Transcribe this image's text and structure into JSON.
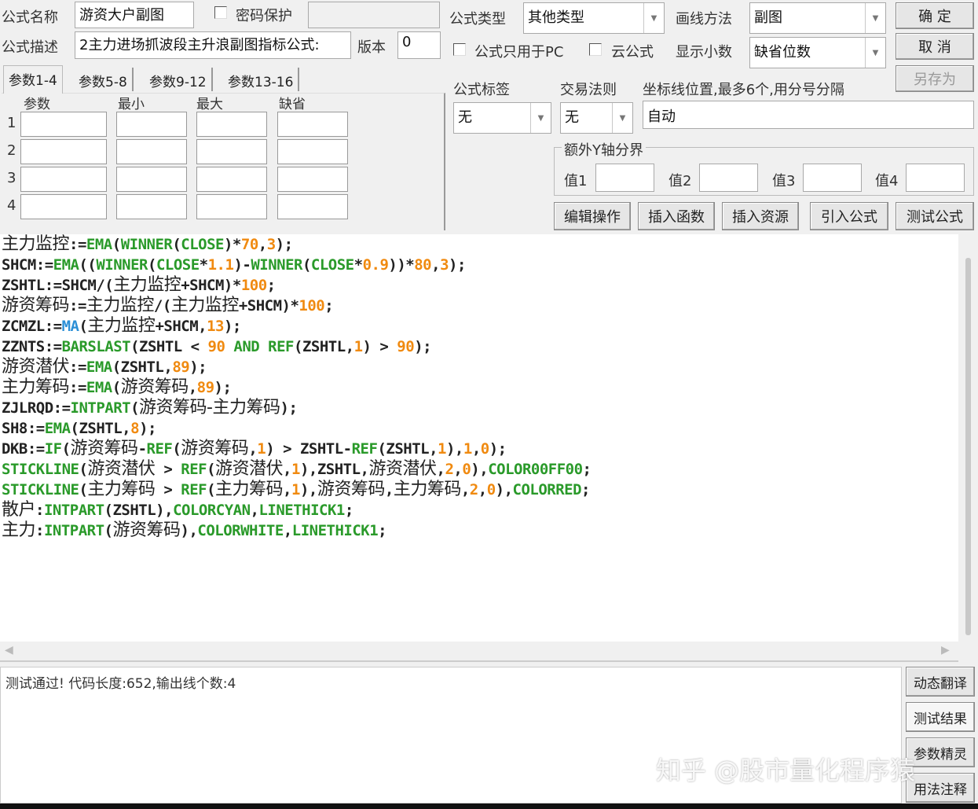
{
  "form": {
    "name_label": "公式名称",
    "name_value": "游资大户副图",
    "password_label": "密码保护",
    "desc_label": "公式描述",
    "desc_value": "2主力进场抓波段主升浪副图指标公式:",
    "version_label": "版本",
    "version_value": "0",
    "type_label": "公式类型",
    "type_value": "其他类型",
    "draw_label": "画线方法",
    "draw_value": "副图",
    "pc_only_label": "公式只用于PC",
    "cloud_label": "云公式",
    "decimal_label": "显示小数",
    "decimal_value": "缺省位数",
    "tag_label": "公式标签",
    "tag_value": "无",
    "trade_label": "交易法则",
    "trade_value": "无",
    "axis_label": "坐标线位置,最多6个,用分号分隔",
    "axis_value": "自动",
    "yaxis_group": "额外Y轴分界",
    "y_values": [
      "值1",
      "值2",
      "值3",
      "值4"
    ]
  },
  "buttons": {
    "ok": "确 定",
    "cancel": "取 消",
    "save_as": "另存为",
    "edit": "编辑操作",
    "insert_func": "插入函数",
    "insert_res": "插入资源",
    "import": "引入公式",
    "test": "测试公式",
    "dyn": "动态翻译",
    "result": "测试结果",
    "wizard": "参数精灵",
    "usage": "用法注释"
  },
  "params": {
    "tabs": [
      "参数1-4",
      "参数5-8",
      "参数9-12",
      "参数13-16"
    ],
    "headers": [
      "参数",
      "最小",
      "最大",
      "缺省"
    ],
    "rows": [
      "1",
      "2",
      "3",
      "4"
    ]
  },
  "code": [
    [
      [
        "c",
        "主力监控"
      ],
      [
        "t",
        ":="
      ],
      [
        "f",
        "EMA"
      ],
      [
        "t",
        "("
      ],
      [
        "f",
        "WINNER"
      ],
      [
        "t",
        "("
      ],
      [
        "f",
        "CLOSE"
      ],
      [
        "t",
        ")*"
      ],
      [
        "n",
        "70"
      ],
      [
        "t",
        ","
      ],
      [
        "n",
        "3"
      ],
      [
        "t",
        ");"
      ]
    ],
    [
      [
        "t",
        "SHCM:="
      ],
      [
        "f",
        "EMA"
      ],
      [
        "t",
        "(("
      ],
      [
        "f",
        "WINNER"
      ],
      [
        "t",
        "("
      ],
      [
        "f",
        "CLOSE"
      ],
      [
        "t",
        "*"
      ],
      [
        "n",
        "1.1"
      ],
      [
        "t",
        ")-"
      ],
      [
        "f",
        "WINNER"
      ],
      [
        "t",
        "("
      ],
      [
        "f",
        "CLOSE"
      ],
      [
        "t",
        "*"
      ],
      [
        "n",
        "0.9"
      ],
      [
        "t",
        "))*"
      ],
      [
        "n",
        "80"
      ],
      [
        "t",
        ","
      ],
      [
        "n",
        "3"
      ],
      [
        "t",
        ");"
      ]
    ],
    [
      [
        "t",
        "ZSHTL:=SHCM/("
      ],
      [
        "c",
        "主力监控"
      ],
      [
        "t",
        "+SHCM)*"
      ],
      [
        "n",
        "100"
      ],
      [
        "t",
        ";"
      ]
    ],
    [
      [
        "c",
        "游资筹码"
      ],
      [
        "t",
        ":="
      ],
      [
        "c",
        "主力监控"
      ],
      [
        "t",
        "/("
      ],
      [
        "c",
        "主力监控"
      ],
      [
        "t",
        "+SHCM)*"
      ],
      [
        "n",
        "100"
      ],
      [
        "t",
        ";"
      ]
    ],
    [
      [
        "t",
        "ZCMZL:="
      ],
      [
        "b",
        "MA"
      ],
      [
        "t",
        "("
      ],
      [
        "c",
        "主力监控"
      ],
      [
        "t",
        "+SHCM,"
      ],
      [
        "n",
        "13"
      ],
      [
        "t",
        ");"
      ]
    ],
    [
      [
        "t",
        "ZZNTS:="
      ],
      [
        "f",
        "BARSLAST"
      ],
      [
        "t",
        "(ZSHTL < "
      ],
      [
        "n",
        "90"
      ],
      [
        "t",
        " "
      ],
      [
        "f",
        "AND"
      ],
      [
        "t",
        " "
      ],
      [
        "f",
        "REF"
      ],
      [
        "t",
        "(ZSHTL,"
      ],
      [
        "n",
        "1"
      ],
      [
        "t",
        ") > "
      ],
      [
        "n",
        "90"
      ],
      [
        "t",
        ");"
      ]
    ],
    [
      [
        "c",
        "游资潜伏"
      ],
      [
        "t",
        ":="
      ],
      [
        "f",
        "EMA"
      ],
      [
        "t",
        "(ZSHTL,"
      ],
      [
        "n",
        "89"
      ],
      [
        "t",
        ");"
      ]
    ],
    [
      [
        "c",
        "主力筹码"
      ],
      [
        "t",
        ":="
      ],
      [
        "f",
        "EMA"
      ],
      [
        "t",
        "("
      ],
      [
        "c",
        "游资筹码"
      ],
      [
        "t",
        ","
      ],
      [
        "n",
        "89"
      ],
      [
        "t",
        ");"
      ]
    ],
    [
      [
        "t",
        "ZJLRQD:="
      ],
      [
        "f",
        "INTPART"
      ],
      [
        "t",
        "("
      ],
      [
        "c",
        "游资筹码-主力筹码"
      ],
      [
        "t",
        ");"
      ]
    ],
    [
      [
        "t",
        "SH8:="
      ],
      [
        "f",
        "EMA"
      ],
      [
        "t",
        "(ZSHTL,"
      ],
      [
        "n",
        "8"
      ],
      [
        "t",
        ");"
      ]
    ],
    [
      [
        "t",
        "DKB:="
      ],
      [
        "f",
        "IF"
      ],
      [
        "t",
        "("
      ],
      [
        "c",
        "游资筹码"
      ],
      [
        "t",
        "-"
      ],
      [
        "f",
        "REF"
      ],
      [
        "t",
        "("
      ],
      [
        "c",
        "游资筹码"
      ],
      [
        "t",
        ","
      ],
      [
        "n",
        "1"
      ],
      [
        "t",
        ") > ZSHTL-"
      ],
      [
        "f",
        "REF"
      ],
      [
        "t",
        "(ZSHTL,"
      ],
      [
        "n",
        "1"
      ],
      [
        "t",
        "),"
      ],
      [
        "n",
        "1"
      ],
      [
        "t",
        ","
      ],
      [
        "n",
        "0"
      ],
      [
        "t",
        ");"
      ]
    ],
    [
      [
        "f",
        "STICKLINE"
      ],
      [
        "t",
        "("
      ],
      [
        "c",
        "游资潜伏"
      ],
      [
        "t",
        " > "
      ],
      [
        "f",
        "REF"
      ],
      [
        "t",
        "("
      ],
      [
        "c",
        "游资潜伏"
      ],
      [
        "t",
        ","
      ],
      [
        "n",
        "1"
      ],
      [
        "t",
        "),ZSHTL,"
      ],
      [
        "c",
        "游资潜伏"
      ],
      [
        "t",
        ","
      ],
      [
        "n",
        "2"
      ],
      [
        "t",
        ","
      ],
      [
        "n",
        "0"
      ],
      [
        "t",
        "),"
      ],
      [
        "f",
        "COLOR00FF00"
      ],
      [
        "t",
        ";"
      ]
    ],
    [
      [
        "f",
        "STICKLINE"
      ],
      [
        "t",
        "("
      ],
      [
        "c",
        "主力筹码"
      ],
      [
        "t",
        " > "
      ],
      [
        "f",
        "REF"
      ],
      [
        "t",
        "("
      ],
      [
        "c",
        "主力筹码"
      ],
      [
        "t",
        ","
      ],
      [
        "n",
        "1"
      ],
      [
        "t",
        "),"
      ],
      [
        "c",
        "游资筹码"
      ],
      [
        "t",
        ","
      ],
      [
        "c",
        "主力筹码"
      ],
      [
        "t",
        ","
      ],
      [
        "n",
        "2"
      ],
      [
        "t",
        ","
      ],
      [
        "n",
        "0"
      ],
      [
        "t",
        "),"
      ],
      [
        "f",
        "COLORRED"
      ],
      [
        "t",
        ";"
      ]
    ],
    [
      [
        "c",
        "散户"
      ],
      [
        "t",
        ":"
      ],
      [
        "f",
        "INTPART"
      ],
      [
        "t",
        "(ZSHTL),"
      ],
      [
        "f",
        "COLORCYAN"
      ],
      [
        "t",
        ","
      ],
      [
        "f",
        "LINETHICK1"
      ],
      [
        "t",
        ";"
      ]
    ],
    [
      [
        "c",
        "主力"
      ],
      [
        "t",
        ":"
      ],
      [
        "f",
        "INTPART"
      ],
      [
        "t",
        "("
      ],
      [
        "c",
        "游资筹码"
      ],
      [
        "t",
        "),"
      ],
      [
        "f",
        "COLORWHITE"
      ],
      [
        "t",
        ","
      ],
      [
        "f",
        "LINETHICK1"
      ],
      [
        "t",
        ";"
      ]
    ]
  ],
  "output": {
    "message": "测试通过! 代码长度:652,输出线个数:4"
  },
  "watermark": "知乎 @股市量化程序猿"
}
